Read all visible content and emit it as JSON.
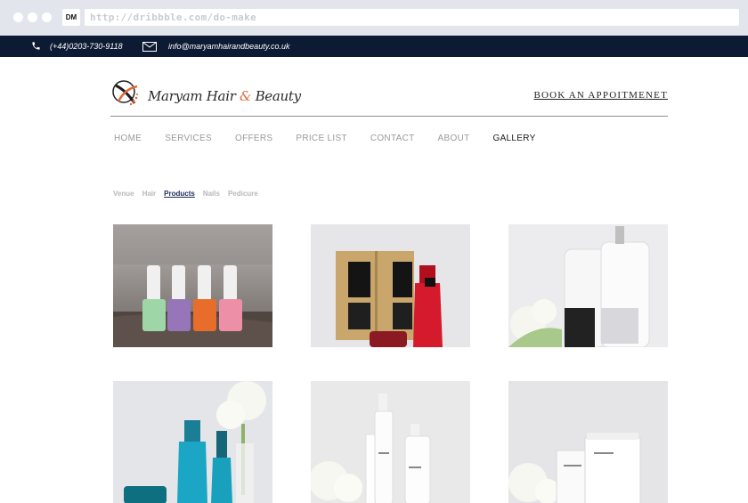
{
  "browser": {
    "favicon_text": "DM",
    "url": "http://dribbble.com/do-make"
  },
  "topbar": {
    "phone": "(+44)0203-730-9118",
    "email": "info@maryamhairandbeauty.co.uk",
    "background_color": "#0c1a33"
  },
  "header": {
    "logo_text_a": "Maryam Hair ",
    "logo_amp": "&",
    "logo_text_b": " Beauty",
    "book_button": "BOOK AN APPOITMENET"
  },
  "nav": {
    "items": [
      "HOME",
      "SERVICES",
      "OFFERS",
      "PRICE LIST",
      "CONTACT",
      "ABOUT",
      "GALLERY"
    ],
    "active": "GALLERY"
  },
  "filters": {
    "items": [
      "Venue",
      "Hair",
      "Products",
      "Nails",
      "Pedicure"
    ],
    "active": "Products"
  },
  "gallery": {
    "images": [
      "nail-polish-bottles-photo",
      "cosmetic-box-and-shampoo-photo",
      "smartbond-bottles-photo",
      "blue-hair-products-photo",
      "professional-skincare-bottles-photo",
      "professional-skincare-tubes-photo"
    ]
  },
  "icons": {
    "phone": "phone-icon",
    "email": "envelope-icon",
    "logo": "logo-emblem-icon"
  }
}
